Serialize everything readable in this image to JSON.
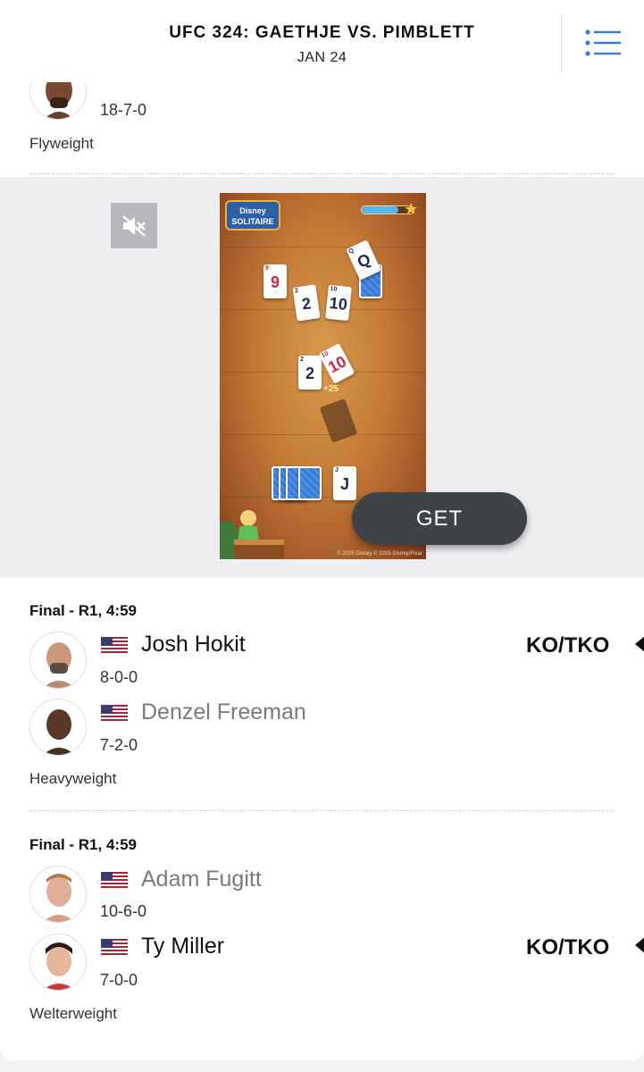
{
  "header": {
    "title": "UFC 324: GAETHJE VS. PIMBLETT",
    "date": "JAN 24",
    "menu_icon": "list-menu-icon"
  },
  "prev_bout": {
    "record": "18-7-0",
    "weight_class": "Flyweight"
  },
  "ad": {
    "mute_icon": "speaker-muted-icon",
    "game_title": "Disney SOLITAIRE",
    "cta_label": "GET",
    "bonus_text": "+25",
    "copyright": "© 2025 Disney  © 2025 Disney/Pixar",
    "cards": [
      "9",
      "2",
      "10",
      "Q",
      "2",
      "10",
      "J"
    ]
  },
  "bouts": [
    {
      "status": "Final - R1, 4:59",
      "fighters": [
        {
          "name": "Josh Hokit",
          "record": "8-0-0",
          "result": "KO/TKO",
          "winner": true,
          "flag": "us-flag"
        },
        {
          "name": "Denzel Freeman",
          "record": "7-2-0",
          "result": "",
          "winner": false,
          "flag": "us-flag"
        }
      ],
      "weight_class": "Heavyweight"
    },
    {
      "status": "Final - R1, 4:59",
      "fighters": [
        {
          "name": "Adam Fugitt",
          "record": "10-6-0",
          "result": "",
          "winner": false,
          "flag": "us-flag"
        },
        {
          "name": "Ty Miller",
          "record": "7-0-0",
          "result": "KO/TKO",
          "winner": true,
          "flag": "us-flag"
        }
      ],
      "weight_class": "Welterweight"
    }
  ],
  "colors": {
    "loser_name": "#7a7a7a",
    "winner_name": "#111111",
    "menu_accent": "#2f7de1"
  }
}
